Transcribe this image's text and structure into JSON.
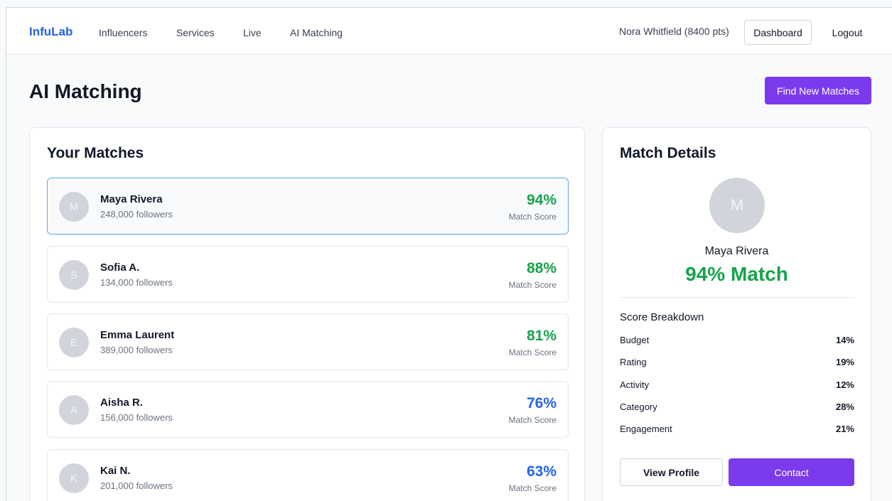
{
  "nav": {
    "brand": "InfuLab",
    "links": [
      "Influencers",
      "Services",
      "Live",
      "AI Matching"
    ],
    "user": "Nora Whitfield (8400 pts)",
    "dashboard": "Dashboard",
    "logout": "Logout"
  },
  "page": {
    "title": "AI Matching",
    "find_button": "Find New Matches"
  },
  "matches": {
    "title": "Your Matches",
    "score_label": "Match Score",
    "items": [
      {
        "initial": "M",
        "name": "Maya Rivera",
        "followers": "248,000 followers",
        "score": "94%",
        "score_color": "#16a34a",
        "selected": true
      },
      {
        "initial": "S",
        "name": "Sofia A.",
        "followers": "134,000 followers",
        "score": "88%",
        "score_color": "#16a34a",
        "selected": false
      },
      {
        "initial": "E",
        "name": "Emma Laurent",
        "followers": "389,000 followers",
        "score": "81%",
        "score_color": "#16a34a",
        "selected": false
      },
      {
        "initial": "A",
        "name": "Aisha R.",
        "followers": "156,000 followers",
        "score": "76%",
        "score_color": "#2563eb",
        "selected": false
      },
      {
        "initial": "K",
        "name": "Kai N.",
        "followers": "201,000 followers",
        "score": "63%",
        "score_color": "#2563eb",
        "selected": false
      }
    ]
  },
  "details": {
    "title": "Match Details",
    "initial": "M",
    "name": "Maya Rivera",
    "score": "94% Match",
    "breakdown_title": "Score Breakdown",
    "breakdown": [
      {
        "label": "Budget",
        "value": "14%"
      },
      {
        "label": "Rating",
        "value": "19%"
      },
      {
        "label": "Activity",
        "value": "12%"
      },
      {
        "label": "Category",
        "value": "28%"
      },
      {
        "label": "Engagement",
        "value": "21%"
      }
    ],
    "view_profile": "View Profile",
    "contact": "Contact"
  },
  "colors": {
    "brand": "#2563eb",
    "accent": "#7c3aed",
    "high_score": "#16a34a",
    "mid_score": "#2563eb"
  }
}
